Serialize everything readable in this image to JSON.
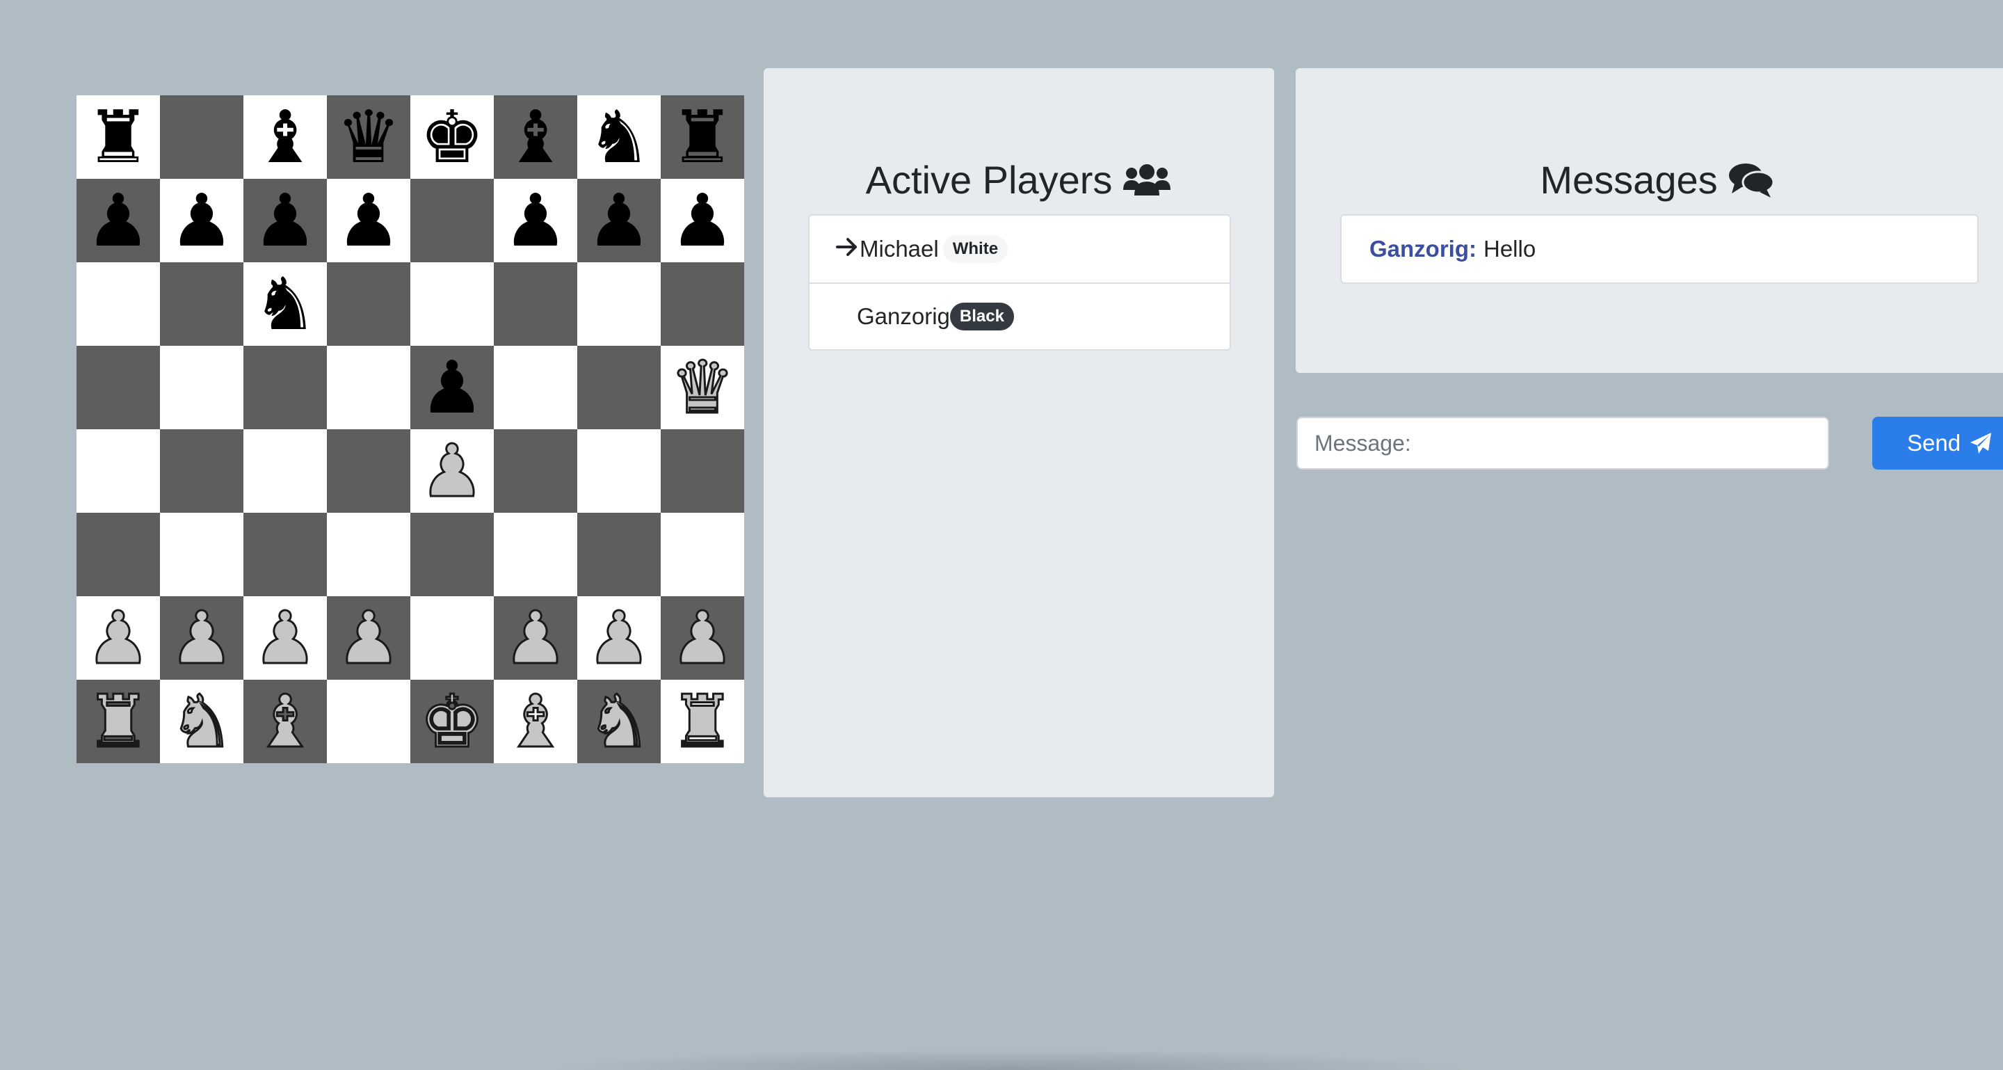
{
  "board": {
    "ranks": [
      [
        "r",
        "_",
        "b",
        "q",
        "k",
        "b",
        "n",
        "r"
      ],
      [
        "p",
        "p",
        "p",
        "p",
        "_",
        "p",
        "p",
        "p"
      ],
      [
        "_",
        "_",
        "n",
        "_",
        "_",
        "_",
        "_",
        "_"
      ],
      [
        "_",
        "_",
        "_",
        "_",
        "p",
        "_",
        "_",
        "Q"
      ],
      [
        "_",
        "_",
        "_",
        "_",
        "P",
        "_",
        "_",
        "_"
      ],
      [
        "_",
        "_",
        "_",
        "_",
        "_",
        "_",
        "_",
        "_"
      ],
      [
        "P",
        "P",
        "P",
        "P",
        "_",
        "P",
        "P",
        "P"
      ],
      [
        "R",
        "N",
        "B",
        "_",
        "K",
        "B",
        "N",
        "R"
      ]
    ],
    "glyphs": {
      "k": "♚",
      "q": "♛",
      "r": "♜",
      "b": "♝",
      "n": "♞",
      "p": "♟",
      "K": "♚",
      "Q": "♛",
      "R": "♜",
      "B": "♝",
      "N": "♞",
      "P": "♟"
    },
    "colors": {
      "light": "#ffffff",
      "dark": "#5e5e5e",
      "black_piece": "#000000",
      "white_piece": "#c6c6c6"
    }
  },
  "players": {
    "title": "Active Players",
    "icon": "users-icon",
    "items": [
      {
        "name": "Michael",
        "badge": "White",
        "current": true
      },
      {
        "name": "Ganzorig",
        "badge": "Black",
        "current": false
      }
    ]
  },
  "messages": {
    "title": "Messages",
    "icon": "comments-icon",
    "items": [
      {
        "sender": "Ganzorig:",
        "text": "Hello"
      }
    ]
  },
  "composer": {
    "placeholder": "Message:",
    "send_label": "Send",
    "send_icon": "paper-plane-icon",
    "accent": "#2b7de9"
  }
}
